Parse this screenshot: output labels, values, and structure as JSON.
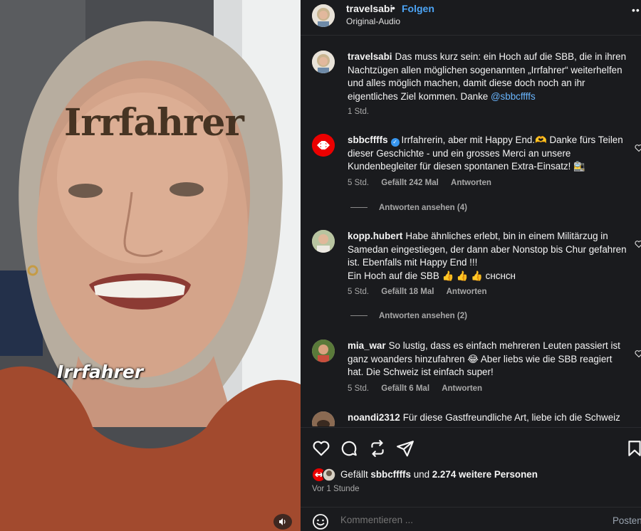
{
  "video": {
    "overlay_title": "Irrfahrer",
    "caption_sticker": "Irrfahrer",
    "mute_icon": "speaker-icon"
  },
  "header": {
    "username": "travelsabi",
    "separator": "•",
    "follow_label": "Folgen",
    "audio_label": "Original-Audio",
    "more_icon": "more-dots-icon"
  },
  "comments": [
    {
      "username": "travelsabi",
      "text": "Das muss kurz sein: ein Hoch auf die SBB, die in ihren Nachtzügen allen möglichen sogenannten „Irrfahrer“ weiterhelfen und alles möglich machen, damit diese doch noch an ihr eigentliches Ziel kommen. Danke ",
      "mention": "@sbbcffffs",
      "time": "1 Std."
    },
    {
      "username": "sbbcffffs",
      "verified": true,
      "text": "Irrfahrerin, aber mit Happy End.🫶 Danke fürs Teilen dieser Geschichte - und ein grosses Merci an unsere Kundenbegleiter für diesen spontanen Extra-Einsatz! 🚉",
      "time": "5 Std.",
      "likes": "Gefällt 242 Mal",
      "reply": "Antworten",
      "view_replies": "Antworten ansehen (4)"
    },
    {
      "username": "kopp.hubert",
      "text": "Habe ähnliches erlebt, bin in einem Militärzug in Samedan eingestiegen, der dann aber Nonstop bis Chur gefahren ist. Ebenfalls mit Happy End !!!",
      "text2": "Ein Hoch auf die SBB 👍 👍 👍 ᴄʜᴄʜᴄʜ",
      "time": "5 Std.",
      "likes": "Gefällt 18 Mal",
      "reply": "Antworten",
      "view_replies": "Antworten ansehen (2)"
    },
    {
      "username": "mia_war",
      "text": "So lustig, dass es einfach mehreren Leuten passiert ist ganz woanders hinzufahren 😂 Aber liebs wie die SBB reagiert hat. Die Schweiz ist einfach super!",
      "time": "5 Std.",
      "likes": "Gefällt 6 Mal",
      "reply": "Antworten"
    },
    {
      "username": "noandi2312",
      "text": "Für diese Gastfreundliche Art, liebe ich die Schweiz"
    }
  ],
  "actions": {
    "like_icon": "heart-icon",
    "comment_icon": "comment-icon",
    "share_icon": "repost-icon",
    "send_icon": "send-icon",
    "save_icon": "bookmark-icon",
    "likes_prefix": "Gefällt ",
    "likes_user": "sbbcffffs",
    "likes_mid": " und ",
    "likes_count": "2.274 weitere Personen",
    "time_ago": "Vor 1 Stunde"
  },
  "composer": {
    "emoji_icon": "emoji-smiley-icon",
    "placeholder": "Kommentieren ...",
    "post_label": "Posten"
  },
  "colors": {
    "panel_bg": "#1a1b1e",
    "link": "#4ca4f5",
    "sbb_red": "#eb0000",
    "secondary_text": "#a8a8a8"
  }
}
